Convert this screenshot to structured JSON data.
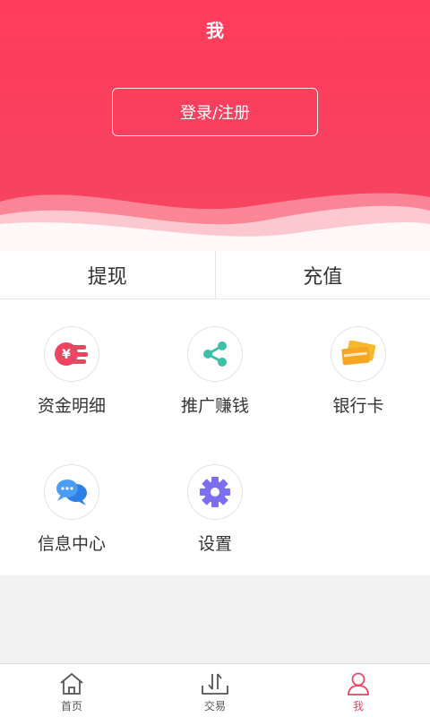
{
  "header": {
    "title": "我",
    "login_label": "登录/注册",
    "bg_color": "#ff3d5a"
  },
  "actions": [
    {
      "label": "提现"
    },
    {
      "label": "充值"
    }
  ],
  "menu": [
    {
      "label": "资金明细",
      "icon": "money-yen-icon",
      "color": "#f14362"
    },
    {
      "label": "推广赚钱",
      "icon": "share-icon",
      "color": "#3cc0a8"
    },
    {
      "label": "银行卡",
      "icon": "bank-card-icon",
      "color": "#f5a623"
    },
    {
      "label": "信息中心",
      "icon": "chat-bubbles-icon",
      "color": "#3b8ff0"
    },
    {
      "label": "设置",
      "icon": "gear-icon",
      "color": "#7b6ff0"
    }
  ],
  "tabbar": {
    "items": [
      {
        "label": "首页",
        "icon": "home-icon"
      },
      {
        "label": "交易",
        "icon": "trade-icon"
      },
      {
        "label": "我",
        "icon": "user-icon",
        "active": true
      }
    ],
    "active_color": "#f14362"
  }
}
